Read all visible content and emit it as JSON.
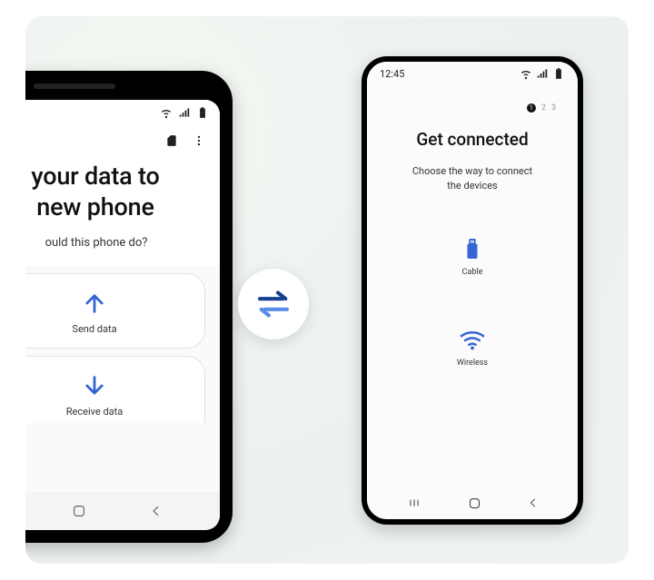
{
  "colors": {
    "accent_blue": "#3564d4",
    "accent_blue_light": "#5a8de8"
  },
  "left_phone": {
    "title_line1": "your data to",
    "title_line2": "new phone",
    "subtitle_partial": "ould this phone do?",
    "card_send_label": "Send data",
    "card_receive_label": "Receive data"
  },
  "right_phone": {
    "clock": "12:45",
    "stepper": {
      "current": "1",
      "step2": "2",
      "step3": "3"
    },
    "title": "Get connected",
    "subtitle_line1": "Choose the way to connect",
    "subtitle_line2": "the devices",
    "option_cable_label": "Cable",
    "option_wireless_label": "Wireless"
  }
}
